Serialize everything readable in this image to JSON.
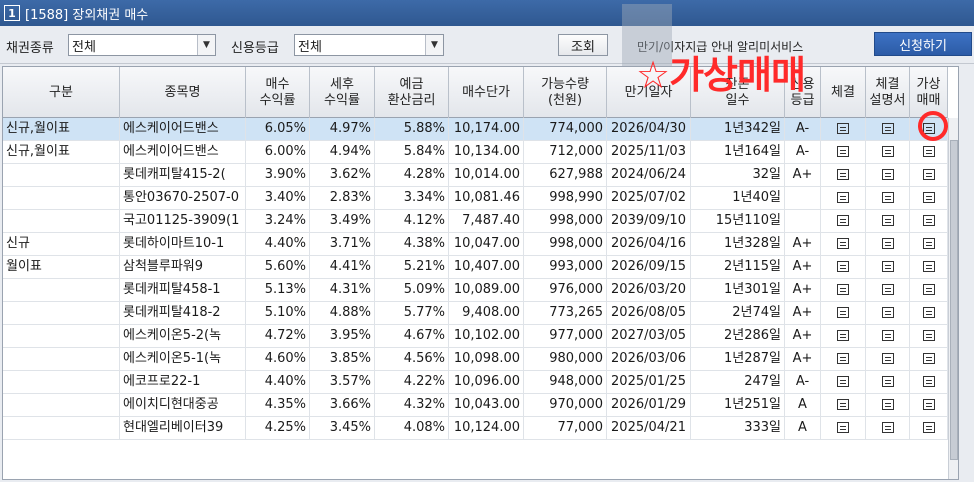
{
  "window": {
    "number": "1",
    "title": "[1588] 장외채권 매수"
  },
  "toolbar": {
    "bond_type_label": "채권종류",
    "bond_type_value": "전체",
    "credit_label": "신용등급",
    "credit_value": "전체",
    "query_button": "조회",
    "notice_text": "만기/이자지급 안내 알리미서비스",
    "apply_button": "신청하기"
  },
  "annotation": {
    "text": "☆가상매매"
  },
  "columns": [
    "구분",
    "종목명",
    "매수\n수익률",
    "세후\n수익률",
    "예금\n환산금리",
    "매수단가",
    "가능수량\n(천원)",
    "만기일자",
    "잔존\n일수",
    "신용\n등급",
    "체결",
    "체결\n설명서",
    "가상\n매매"
  ],
  "rows": [
    [
      "신규,월이표",
      "에스케이어드밴스",
      "6.05%",
      "4.97%",
      "5.88%",
      "10,174.00",
      "774,000",
      "2026/04/30",
      "1년342일",
      "A-"
    ],
    [
      "신규,월이표",
      "에스케이어드밴스",
      "6.00%",
      "4.94%",
      "5.84%",
      "10,134.00",
      "712,000",
      "2025/11/03",
      "1년164일",
      "A-"
    ],
    [
      "",
      "롯데캐피탈415-2(",
      "3.90%",
      "3.62%",
      "4.28%",
      "10,014.00",
      "627,988",
      "2024/06/24",
      "32일",
      "A+"
    ],
    [
      "",
      "통안03670-2507-0",
      "3.40%",
      "2.83%",
      "3.34%",
      "10,081.46",
      "998,990",
      "2025/07/02",
      "1년40일",
      ""
    ],
    [
      "",
      "국고01125-3909(1",
      "3.24%",
      "3.49%",
      "4.12%",
      "7,487.40",
      "998,000",
      "2039/09/10",
      "15년110일",
      ""
    ],
    [
      "신규",
      "롯데하이마트10-1",
      "4.40%",
      "3.71%",
      "4.38%",
      "10,047.00",
      "998,000",
      "2026/04/16",
      "1년328일",
      "A+"
    ],
    [
      "월이표",
      "삼척블루파워9",
      "5.60%",
      "4.41%",
      "5.21%",
      "10,407.00",
      "993,000",
      "2026/09/15",
      "2년115일",
      "A+"
    ],
    [
      "",
      "롯데캐피탈458-1",
      "5.13%",
      "4.31%",
      "5.09%",
      "10,089.00",
      "976,000",
      "2026/03/20",
      "1년301일",
      "A+"
    ],
    [
      "",
      "롯데캐피탈418-2",
      "5.10%",
      "4.88%",
      "5.77%",
      "9,408.00",
      "773,265",
      "2026/08/05",
      "2년74일",
      "A+"
    ],
    [
      "",
      "에스케이온5-2(녹",
      "4.72%",
      "3.95%",
      "4.67%",
      "10,102.00",
      "977,000",
      "2027/03/05",
      "2년286일",
      "A+"
    ],
    [
      "",
      "에스케이온5-1(녹",
      "4.60%",
      "3.85%",
      "4.56%",
      "10,098.00",
      "980,000",
      "2026/03/06",
      "1년287일",
      "A+"
    ],
    [
      "",
      "에코프로22-1",
      "4.40%",
      "3.57%",
      "4.22%",
      "10,096.00",
      "948,000",
      "2025/01/25",
      "247일",
      "A-"
    ],
    [
      "",
      "에이치디현대중공",
      "4.35%",
      "3.66%",
      "4.32%",
      "10,043.00",
      "970,000",
      "2026/01/29",
      "1년251일",
      "A"
    ],
    [
      "",
      "현대엘리베이터39",
      "4.25%",
      "3.45%",
      "4.08%",
      "10,124.00",
      "77,000",
      "2025/04/21",
      "333일",
      "A"
    ]
  ]
}
